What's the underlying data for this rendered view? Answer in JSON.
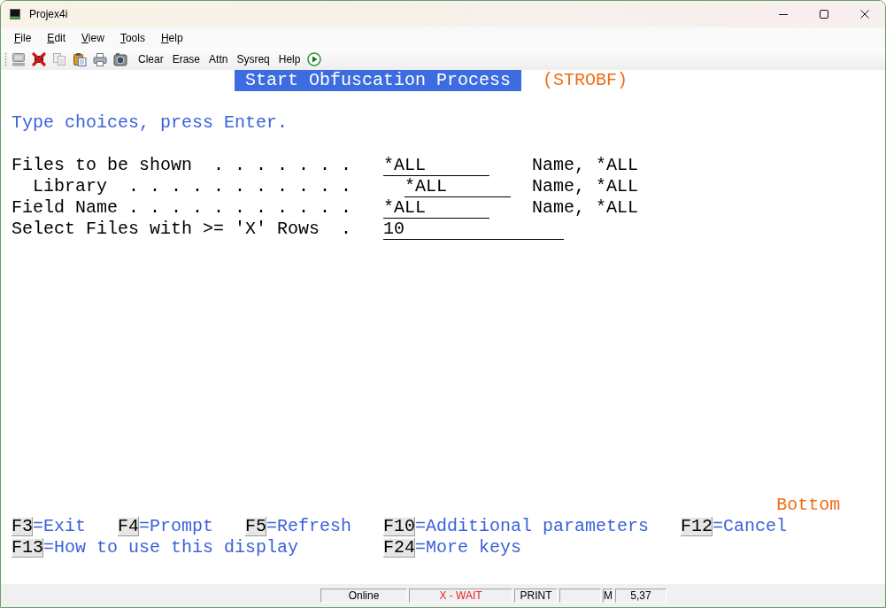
{
  "window": {
    "title": "Projex4i"
  },
  "menu_bar": [
    "File",
    "Edit",
    "View",
    "Tools",
    "Help"
  ],
  "toolbar": {
    "buttons": [
      "Clear",
      "Erase",
      "Attn",
      "Sysreq",
      "Help"
    ]
  },
  "screen": {
    "title": "Start Obfuscation Process",
    "command": "(STROBF)",
    "instruction": "Type choices, press Enter.",
    "fields": [
      {
        "label": "Files to be shown",
        "leader": ". . . . . . .",
        "kind": "name",
        "value": "*ALL",
        "hint": "Name, *ALL",
        "children": [
          {
            "label": "Library",
            "leader": ". . . . . . . . . . .",
            "kind": "name",
            "value": "*ALL",
            "hint": "Name, *ALL"
          }
        ]
      },
      {
        "label": "Field Name",
        "leader": ". . . . . . . . . . .",
        "kind": "name",
        "value": "*ALL",
        "hint": "Name, *ALL"
      },
      {
        "label": "Select Files with >= 'X' Rows",
        "leader": ".",
        "kind": "count",
        "value": "10"
      }
    ],
    "more": "Bottom",
    "function_key_lines": [
      {
        "keys": [
          {
            "key": "F3",
            "label": "=Exit"
          },
          {
            "key": "F4",
            "label": "=Prompt"
          },
          {
            "key": "F5",
            "label": "=Refresh"
          },
          {
            "key": "F10",
            "label": "=Additional parameters"
          },
          {
            "key": "F12",
            "label": "=Cancel"
          }
        ]
      },
      {
        "keys": [
          {
            "key": "F13",
            "label": "=How to use this display"
          },
          {
            "key": "F24",
            "label": "=More keys"
          }
        ]
      }
    ]
  },
  "status_bar": [
    {
      "kind": "text",
      "text": "Online"
    },
    {
      "kind": "alert",
      "text": "X - WAIT"
    },
    {
      "kind": "text",
      "text": "PRINT"
    },
    {
      "kind": "empty"
    },
    {
      "kind": "text",
      "text": "M"
    },
    {
      "kind": "text",
      "text": "5,37"
    }
  ]
}
